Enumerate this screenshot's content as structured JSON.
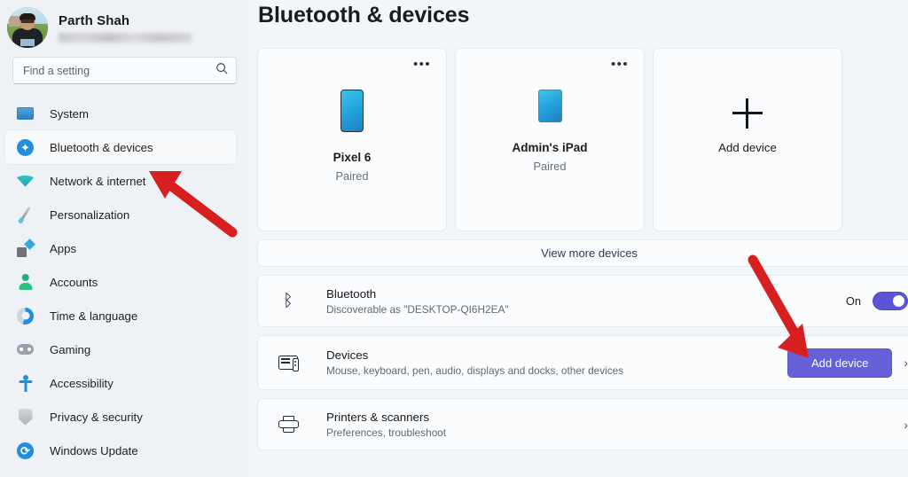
{
  "window": {
    "title": "Bluetooth & devices"
  },
  "profile": {
    "name": "Parth Shah",
    "email_redacted": true,
    "avatar_name": "user-avatar"
  },
  "search": {
    "placeholder": "Find a setting",
    "value": "",
    "icon": "search-icon"
  },
  "sidebar": {
    "items": [
      {
        "label": "System",
        "icon": "monitor-icon",
        "selected": false
      },
      {
        "label": "Bluetooth & devices",
        "icon": "bluetooth-icon",
        "selected": true
      },
      {
        "label": "Network & internet",
        "icon": "wifi-icon",
        "selected": false
      },
      {
        "label": "Personalization",
        "icon": "paintbrush-icon",
        "selected": false
      },
      {
        "label": "Apps",
        "icon": "apps-icon",
        "selected": false
      },
      {
        "label": "Accounts",
        "icon": "person-icon",
        "selected": false
      },
      {
        "label": "Time & language",
        "icon": "clock-icon",
        "selected": false
      },
      {
        "label": "Gaming",
        "icon": "gamepad-icon",
        "selected": false
      },
      {
        "label": "Accessibility",
        "icon": "accessibility-icon",
        "selected": false
      },
      {
        "label": "Privacy & security",
        "icon": "shield-icon",
        "selected": false
      },
      {
        "label": "Windows Update",
        "icon": "update-icon",
        "selected": false
      }
    ]
  },
  "main": {
    "title": "Bluetooth & devices",
    "device_cards": [
      {
        "name": "Pixel 6",
        "status": "Paired",
        "icon": "phone-icon",
        "menu": "more-options-icon"
      },
      {
        "name": "Admin's iPad",
        "status": "Paired",
        "icon": "tablet-icon",
        "menu": "more-options-icon"
      }
    ],
    "add_device_card": {
      "label": "Add device",
      "icon": "plus-icon"
    },
    "view_more": {
      "label": "View more devices"
    },
    "settings_rows": [
      {
        "title": "Bluetooth",
        "subtitle": "Discoverable as \"DESKTOP-QI6H2EA\"",
        "icon": "bluetooth-icon",
        "toggle_label": "On",
        "toggle_state": "on"
      },
      {
        "title": "Devices",
        "subtitle": "Mouse, keyboard, pen, audio, displays and docks, other devices",
        "icon": "devices-icon",
        "button_label": "Add device",
        "chevron": "chevron-right-icon"
      },
      {
        "title": "Printers & scanners",
        "subtitle": "Preferences, troubleshoot",
        "icon": "printer-icon",
        "chevron": "chevron-right-icon"
      }
    ]
  },
  "annotations": {
    "arrow_color": "#d81f1f",
    "arrows": [
      {
        "name": "arrow-to-bluetooth-sidebar",
        "points_to": "Bluetooth & devices"
      },
      {
        "name": "arrow-to-add-device-button",
        "points_to": "Add device"
      }
    ]
  },
  "colors": {
    "accent": "#6761d9",
    "toggle_on": "#5b55d6",
    "sidebar_bg": "#eef2f7",
    "card_bg": "#fbfcfe",
    "arrow_red": "#d81f1f"
  }
}
